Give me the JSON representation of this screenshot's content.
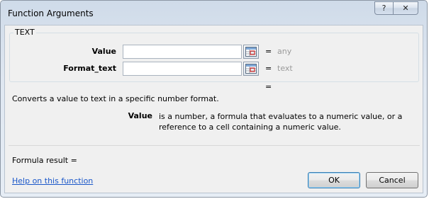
{
  "window": {
    "title": "Function Arguments",
    "help_symbol": "?",
    "close_symbol": "✕"
  },
  "function": {
    "name": "TEXT",
    "args": [
      {
        "label": "Value",
        "value": "",
        "result": "any"
      },
      {
        "label": "Format_text",
        "value": "",
        "result": "text"
      }
    ],
    "eq_symbol": "=",
    "result_eq": "=",
    "description": "Converts a value to text in a specific number format.",
    "arg_help_name": "Value",
    "arg_help_text": "is a number, a formula that evaluates to a numeric value, or a reference to a cell containing a numeric value."
  },
  "footer": {
    "formula_result": "Formula result =",
    "help_link": "Help on this function",
    "ok": "OK",
    "cancel": "Cancel"
  },
  "colors": {
    "accent": "#3c7fb1",
    "link": "#1a57c9",
    "placeholder_result": "#9a9a9a"
  }
}
